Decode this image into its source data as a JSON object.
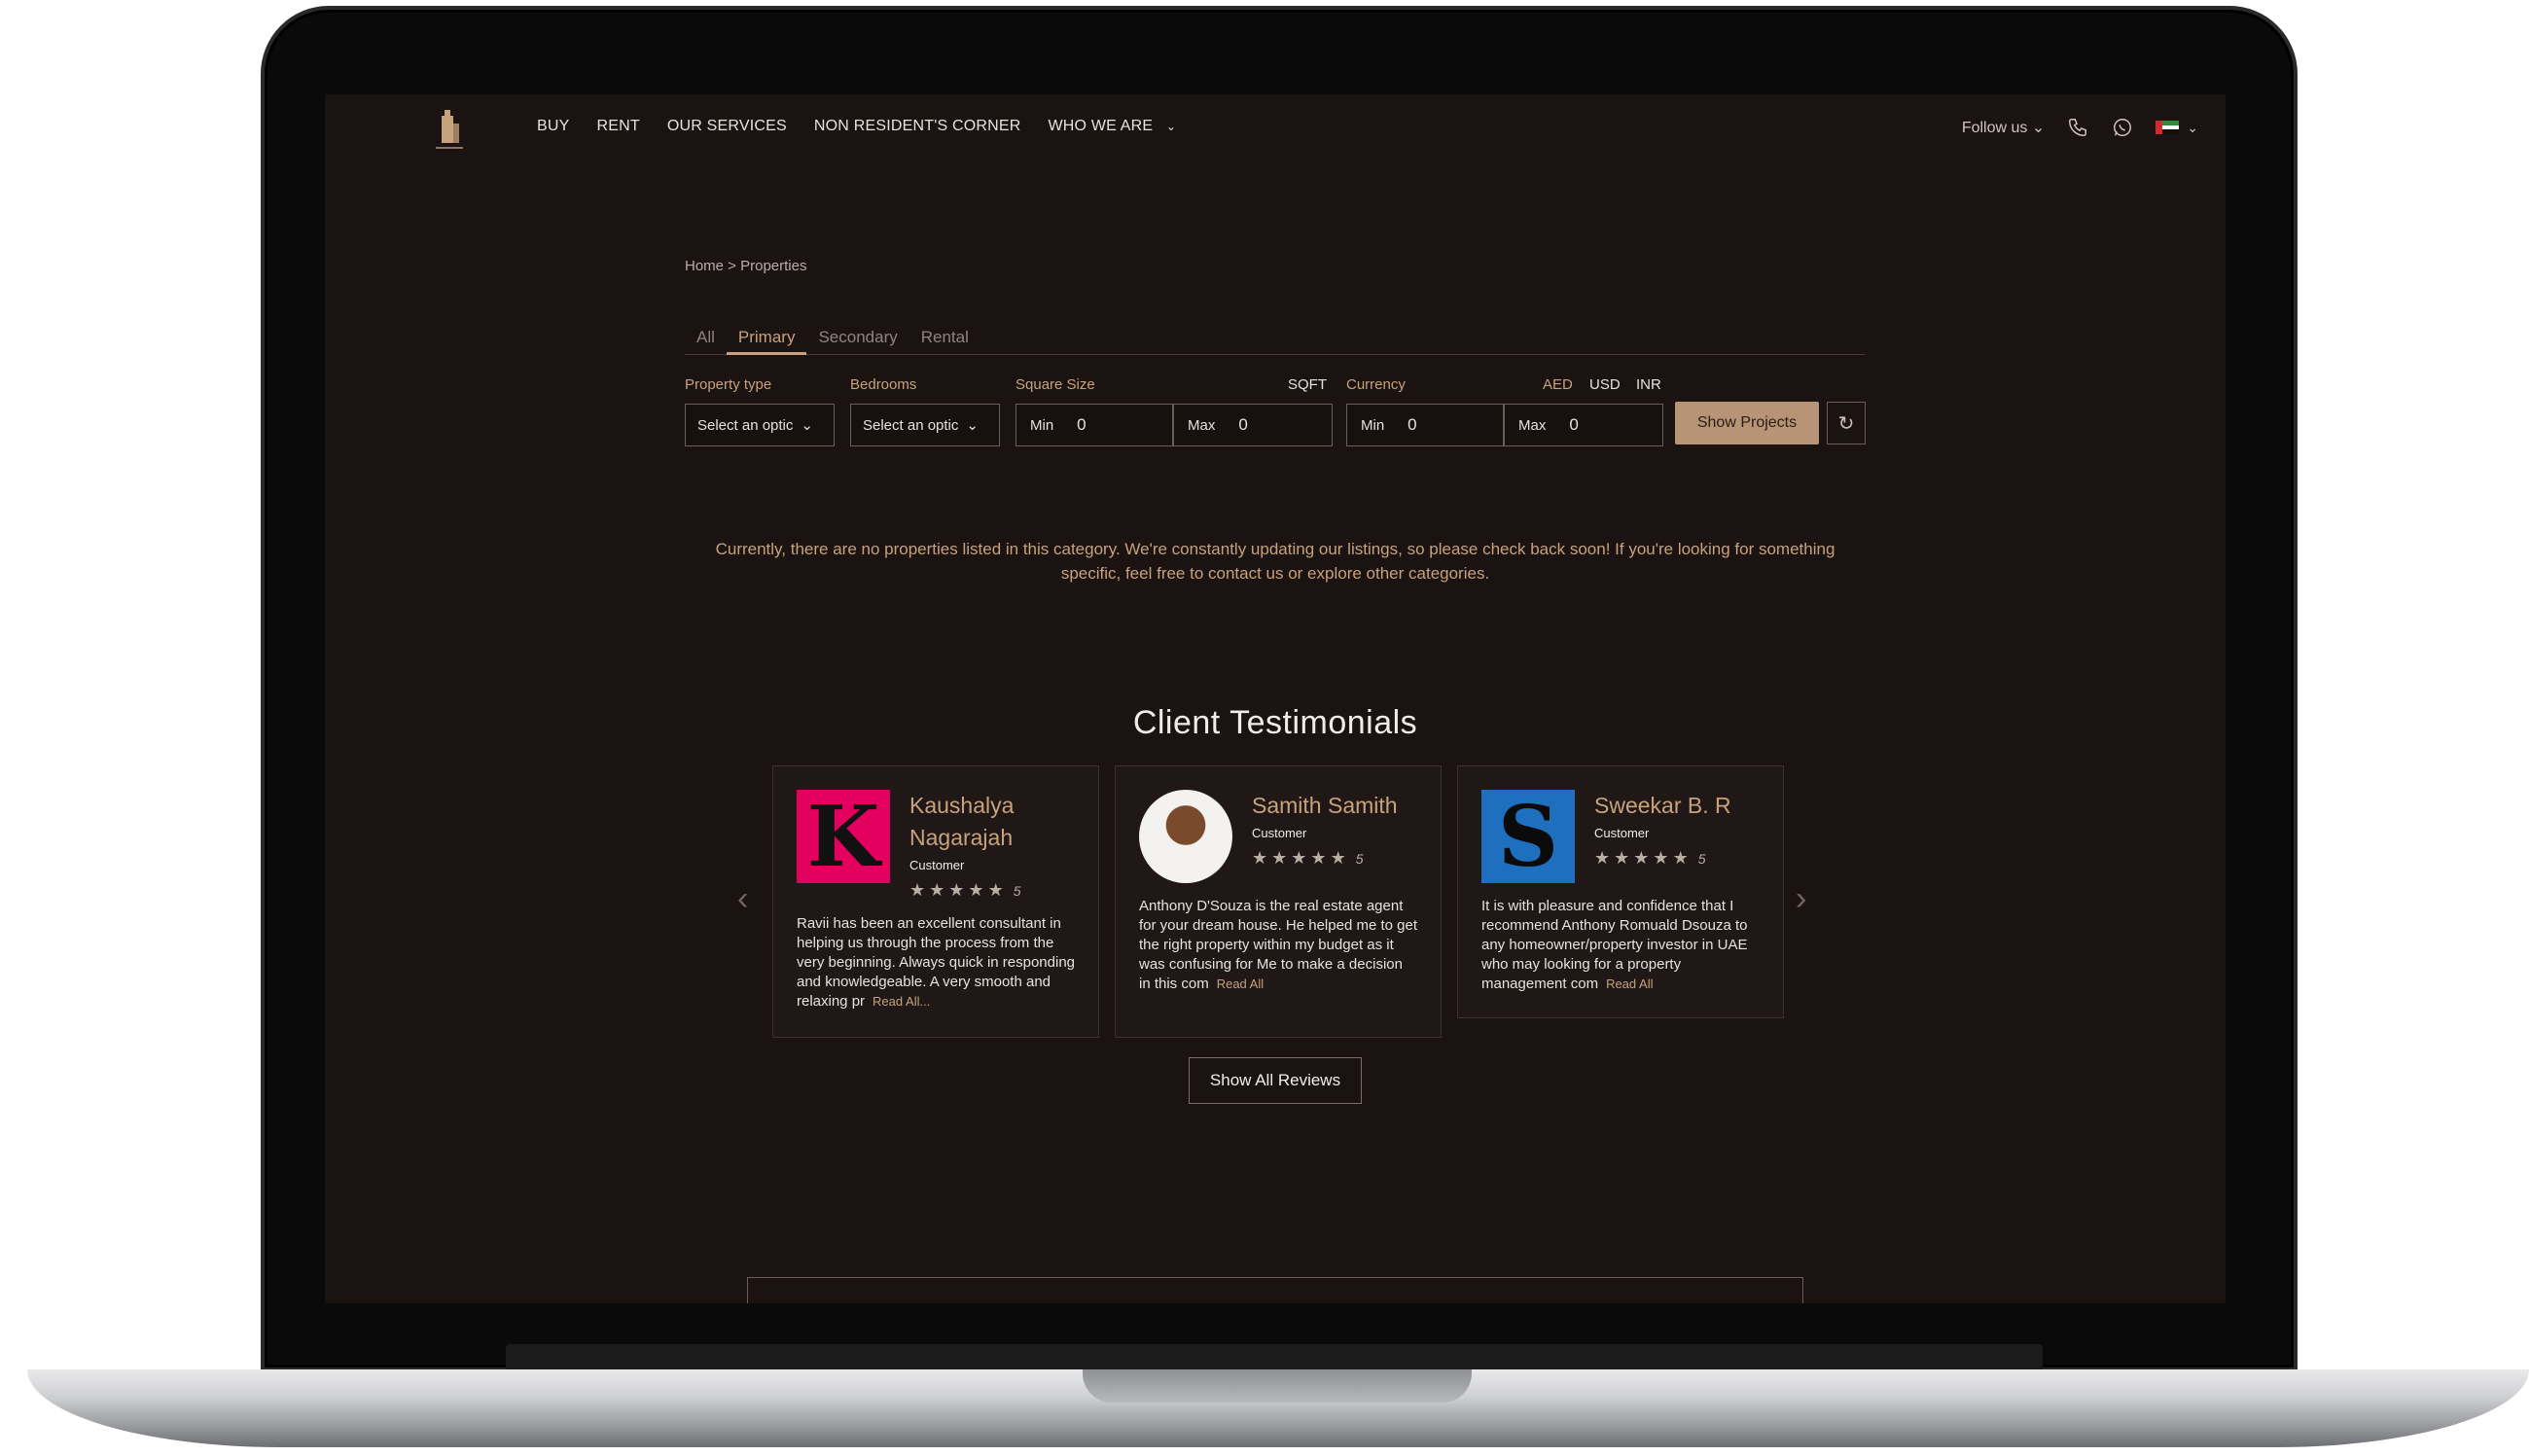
{
  "nav": {
    "links": [
      "BUY",
      "RENT",
      "OUR SERVICES",
      "NON RESIDENT'S CORNER",
      "WHO WE ARE"
    ],
    "follow_label": "Follow us"
  },
  "breadcrumb": "Home > Properties",
  "tabs": [
    "All",
    "Primary",
    "Secondary",
    "Rental"
  ],
  "filters": {
    "property_type_label": "Property type",
    "bedrooms_label": "Bedrooms",
    "select_placeholder": "Select an optic",
    "square_size_label": "Square Size",
    "sqft_label": "SQFT",
    "currency_label": "Currency",
    "currencies": [
      "AED",
      "USD",
      "INR"
    ],
    "min_label": "Min",
    "max_label": "Max",
    "sq_min": "0",
    "sq_max": "0",
    "cur_min": "0",
    "cur_max": "0",
    "show_button": "Show Projects"
  },
  "empty_message": "Currently, there are no properties listed in this category. We're constantly updating our listings, so please check back soon! If you're looking for something specific, feel free to contact us or explore other categories.",
  "testimonials": {
    "title": "Client Testimonials",
    "cards": [
      {
        "name": "Kaushalya Nagarajah",
        "role": "Customer",
        "rating": 5,
        "rating_text": "5",
        "avatar_letter": "K",
        "review": "Ravii has been an excellent consultant in helping us through the process from the very beginning. Always quick in responding and knowledgeable. A very smooth and relaxing pr",
        "read_more": "Read All..."
      },
      {
        "name": "Samith Samith",
        "role": "Customer",
        "rating": 5,
        "rating_text": "5",
        "review": "Anthony D'Souza is the real estate agent for your dream house. He helped me to get the right property within my budget as it was confusing for Me to make a decision in this com",
        "read_more": "Read All"
      },
      {
        "name": "Sweekar B. R",
        "role": "Customer",
        "rating": 5,
        "rating_text": "5",
        "avatar_letter": "S",
        "review": "It is with pleasure and confidence that I recommend Anthony Romuald Dsouza to any homeowner/property investor in UAE who may looking for a property management com",
        "read_more": "Read All"
      }
    ],
    "show_all": "Show All Reviews"
  },
  "colors": {
    "accent": "#c7a27c",
    "button": "#b89476",
    "background": "#1a1311"
  }
}
